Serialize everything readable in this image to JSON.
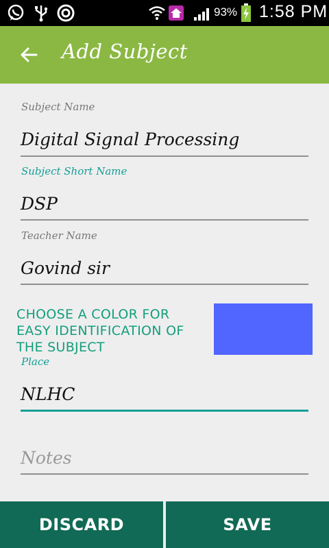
{
  "status_bar": {
    "battery": "93%",
    "time": "1:58 PM",
    "icons": [
      "whatsapp-icon",
      "usb-icon",
      "app-icon",
      "wifi-icon",
      "home-icon",
      "signal-icon",
      "battery-charging-icon"
    ]
  },
  "toolbar": {
    "title": "Add Subject",
    "back_icon": "arrow-left-icon"
  },
  "form": {
    "subject_name": {
      "label": "Subject Name",
      "value": "Digital Signal Processing"
    },
    "short_name": {
      "label": "Subject Short Name",
      "value": "DSP"
    },
    "teacher_name": {
      "label": "Teacher Name",
      "value": "Govind sir"
    },
    "color": {
      "label": "CHOOSE A COLOR FOR EASY IDENTIFICATION OF THE SUBJECT",
      "value": "#5165ff"
    },
    "place": {
      "label": "Place",
      "value": "NLHC"
    },
    "notes": {
      "placeholder": "Notes"
    }
  },
  "buttons": {
    "discard": "DISCARD",
    "save": "SAVE"
  },
  "colors": {
    "toolbar": "#8bb843",
    "accent": "#139e96",
    "button": "#116a55",
    "background": "#eeeeee"
  }
}
